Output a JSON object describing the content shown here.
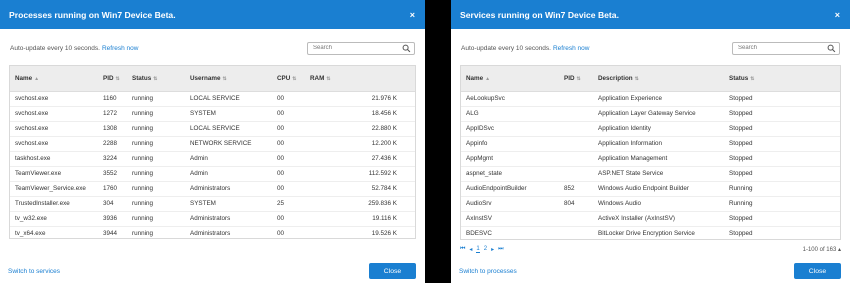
{
  "left": {
    "title": "Processes running on Win7 Device Beta.",
    "close_icon": "×",
    "auto_text": "Auto-update every 10 seconds.",
    "refresh": "Refresh now",
    "search_placeholder": "Search",
    "columns": [
      "Name",
      "PID",
      "Status",
      "Username",
      "CPU",
      "RAM"
    ],
    "rows": [
      [
        "svchost.exe",
        "1160",
        "running",
        "LOCAL SERVICE",
        "00",
        "21.976 K"
      ],
      [
        "svchost.exe",
        "1272",
        "running",
        "SYSTEM",
        "00",
        "18.456 K"
      ],
      [
        "svchost.exe",
        "1308",
        "running",
        "LOCAL SERVICE",
        "00",
        "22.880 K"
      ],
      [
        "svchost.exe",
        "2288",
        "running",
        "NETWORK SERVICE",
        "00",
        "12.200 K"
      ],
      [
        "taskhost.exe",
        "3224",
        "running",
        "Admin",
        "00",
        "27.436 K"
      ],
      [
        "TeamViewer.exe",
        "3552",
        "running",
        "Admin",
        "00",
        "112.592 K"
      ],
      [
        "TeamViewer_Service.exe",
        "1760",
        "running",
        "Administrators",
        "00",
        "52.784 K"
      ],
      [
        "TrustedInstaller.exe",
        "304",
        "running",
        "SYSTEM",
        "25",
        "259.836 K"
      ],
      [
        "tv_w32.exe",
        "3936",
        "running",
        "Administrators",
        "00",
        "19.116 K"
      ],
      [
        "tv_x64.exe",
        "3944",
        "running",
        "Administrators",
        "00",
        "19.526 K"
      ]
    ],
    "switch_link": "Switch to services",
    "close_button": "Close"
  },
  "right": {
    "title": "Services running on Win7 Device Beta.",
    "close_icon": "×",
    "auto_text": "Auto-update every 10 seconds.",
    "refresh": "Refresh now",
    "search_placeholder": "Search",
    "columns": [
      "Name",
      "PID",
      "Description",
      "Status"
    ],
    "rows": [
      [
        "AeLookupSvc",
        "",
        "Application Experience",
        "Stopped"
      ],
      [
        "ALG",
        "",
        "Application Layer Gateway Service",
        "Stopped"
      ],
      [
        "AppIDSvc",
        "",
        "Application Identity",
        "Stopped"
      ],
      [
        "Appinfo",
        "",
        "Application Information",
        "Stopped"
      ],
      [
        "AppMgmt",
        "",
        "Application Management",
        "Stopped"
      ],
      [
        "aspnet_state",
        "",
        "ASP.NET State Service",
        "Stopped"
      ],
      [
        "AudioEndpointBuilder",
        "852",
        "Windows Audio Endpoint Builder",
        "Running"
      ],
      [
        "AudioSrv",
        "804",
        "Windows Audio",
        "Running"
      ],
      [
        "AxInstSV",
        "",
        "ActiveX Installer (AxInstSV)",
        "Stopped"
      ],
      [
        "BDESVC",
        "",
        "BitLocker Drive Encryption Service",
        "Stopped"
      ]
    ],
    "pager": {
      "first": "⏮",
      "prev": "◂",
      "page1": "1",
      "page2": "2",
      "next": "▸",
      "last": "⏭",
      "range": "1-100 of 163",
      "range_icon": "▴"
    },
    "switch_link": "Switch to processes",
    "close_button": "Close"
  },
  "colors": {
    "accent": "#1a7fd1",
    "header_bg": "#ededed",
    "backdrop": "#000000"
  }
}
